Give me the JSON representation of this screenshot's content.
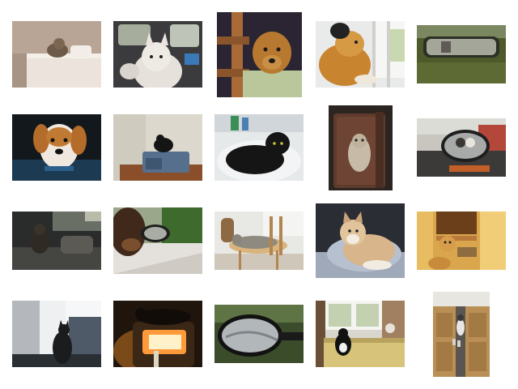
{
  "gallery": {
    "subjects": [
      "cat-on-cabinet",
      "white-husky-in-car",
      "dog-behind-chair",
      "dogs-at-window",
      "car-rearview-mirror",
      "dog-in-car-window",
      "black-cat-on-box",
      "black-cat-in-sink",
      "cat-in-suitcase",
      "dogs-in-side-mirror",
      "cat-in-car",
      "dog-and-side-mirror",
      "cat-on-chair",
      "akita-on-cushion",
      "dog-on-stairs",
      "cat-silhouette-window",
      "cat-on-heater",
      "car-side-mirror",
      "cat-on-window-seat",
      "cat-behind-door"
    ]
  }
}
